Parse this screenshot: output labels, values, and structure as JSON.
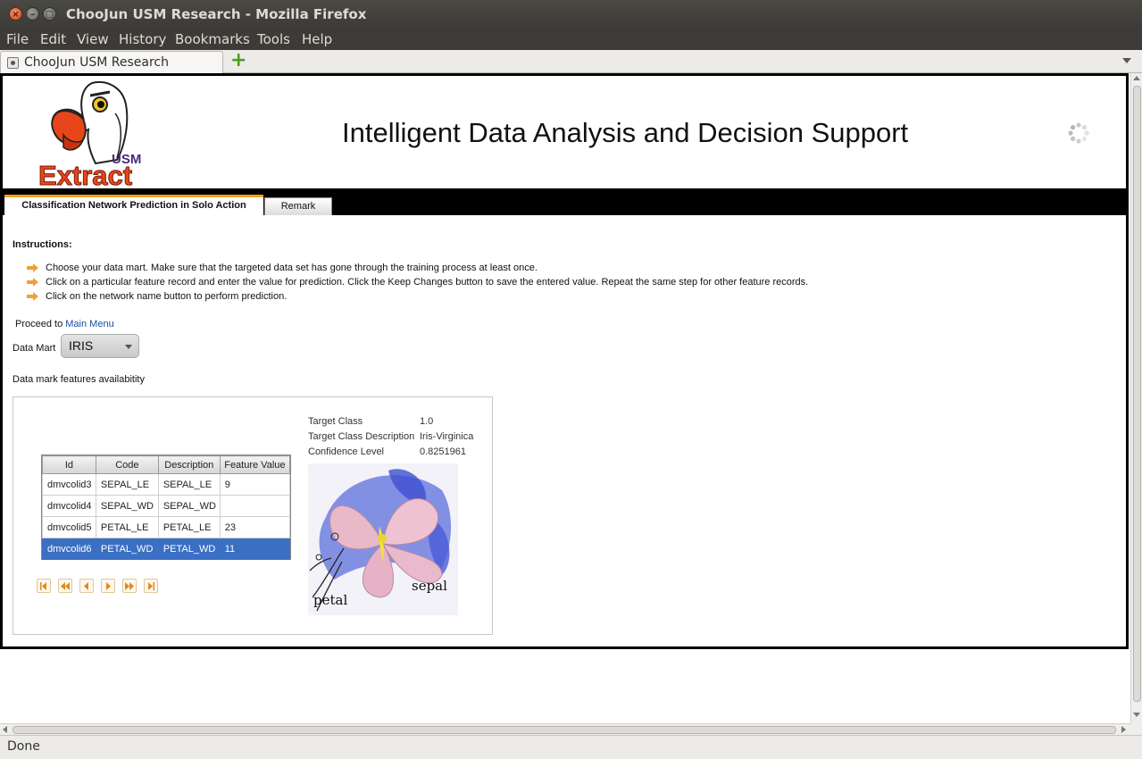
{
  "window": {
    "title": "ChooJun USM Research - Mozilla Firefox"
  },
  "menubar": {
    "items": [
      "File",
      "Edit",
      "View",
      "History",
      "Bookmarks",
      "Tools",
      "Help"
    ]
  },
  "browser_tabs": {
    "active_tab": "ChooJun USM Research"
  },
  "status": {
    "text": "Done"
  },
  "page": {
    "logo_text": "Extract",
    "logo_subtext": "USM",
    "title": "Intelligent Data Analysis and Decision Support",
    "tabs": [
      {
        "label": "Classification Network Prediction in Solo Action"
      },
      {
        "label": "Remark"
      }
    ],
    "instructions_heading": "Instructions:",
    "instructions": [
      "Choose your data mart. Make sure that the targeted data set has gone through the training process at least once.",
      "Click on a particular feature record and enter the value for prediction. Click the Keep Changes button to save the entered value. Repeat the same step for other feature records.",
      "Click on the network name button to perform prediction."
    ],
    "proceed_prefix": "Proceed to",
    "proceed_link": "Main Menu",
    "datamart_label": "Data Mart",
    "datamart_value": "IRIS",
    "availability_label": "Data mark features availabitity",
    "table": {
      "headers": [
        "Id",
        "Code",
        "Description",
        "Feature Value"
      ],
      "rows": [
        [
          "dmvcolid3",
          "SEPAL_LE",
          "SEPAL_LE",
          "9"
        ],
        [
          "dmvcolid4",
          "SEPAL_WD",
          "SEPAL_WD",
          ""
        ],
        [
          "dmvcolid5",
          "PETAL_LE",
          "PETAL_LE",
          "23"
        ],
        [
          "dmvcolid6",
          "PETAL_WD",
          "PETAL_WD",
          "11"
        ]
      ],
      "selected_row": 3
    },
    "result": {
      "target_class_label": "Target Class",
      "target_class_value": "1.0",
      "target_desc_label": "Target Class Description",
      "target_desc_value": "Iris-Virginica",
      "confidence_label": "Confidence Level",
      "confidence_value": "0.8251961"
    },
    "image_labels": {
      "petal": "petal",
      "sepal": "sepal"
    }
  },
  "colors": {
    "accent_tab": "#f3a21b",
    "selection": "#3a6fc4",
    "link": "#1a4fa0"
  }
}
